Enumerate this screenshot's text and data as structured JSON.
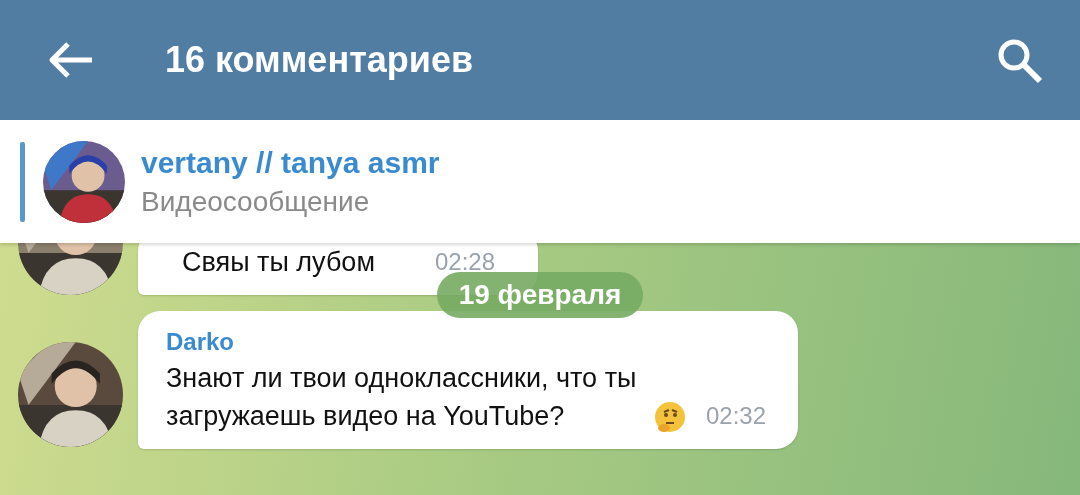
{
  "header": {
    "title": "16 комментариев"
  },
  "pinned": {
    "name": "vertany // tanya asmr",
    "subtitle": "Видеосообщение"
  },
  "messages": [
    {
      "kind": "message",
      "text": "Свяы ты лубом",
      "time": "02:28"
    },
    {
      "kind": "date",
      "text": "19 февраля"
    },
    {
      "kind": "message",
      "author": "Darko",
      "text": "Знают ли твои одноклассники, что ты загружаешь видео на YouTube?",
      "emoji": true,
      "time": "02:32"
    }
  ]
}
